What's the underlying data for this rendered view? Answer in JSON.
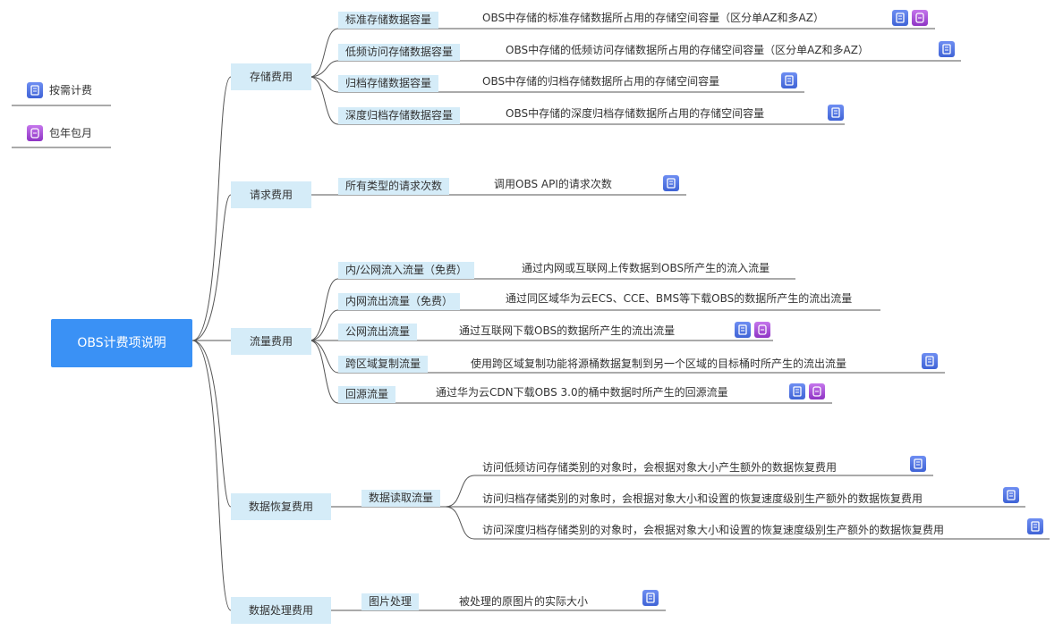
{
  "legend": [
    {
      "icon": "ondemand-icon",
      "label": "按需计费"
    },
    {
      "icon": "yearly-monthly-icon",
      "label": "包年包月"
    }
  ],
  "root": "OBS计费项说明",
  "categories": [
    {
      "label": "存储费用",
      "items": [
        {
          "label": "标准存储数据容量",
          "desc": "OBS中存储的标准存储数据所占用的存储空间容量（区分单AZ和多AZ）",
          "billing": [
            "ondemand",
            "yearly"
          ]
        },
        {
          "label": "低频访问存储数据容量",
          "desc": "OBS中存储的低频访问存储数据所占用的存储空间容量（区分单AZ和多AZ）",
          "billing": [
            "ondemand"
          ]
        },
        {
          "label": "归档存储数据容量",
          "desc": "OBS中存储的归档存储数据所占用的存储空间容量",
          "billing": [
            "ondemand"
          ]
        },
        {
          "label": "深度归档存储数据容量",
          "desc": "OBS中存储的深度归档存储数据所占用的存储空间容量",
          "billing": [
            "ondemand"
          ]
        }
      ]
    },
    {
      "label": "请求费用",
      "items": [
        {
          "label": "所有类型的请求次数",
          "desc": "调用OBS API的请求次数",
          "billing": [
            "ondemand"
          ]
        }
      ]
    },
    {
      "label": "流量费用",
      "items": [
        {
          "label": "内/公网流入流量（免费）",
          "desc": "通过内网或互联网上传数据到OBS所产生的流入流量",
          "billing": []
        },
        {
          "label": "内网流出流量（免费）",
          "desc": "通过同区域华为云ECS、CCE、BMS等下载OBS的数据所产生的流出流量",
          "billing": []
        },
        {
          "label": "公网流出流量",
          "desc": "通过互联网下载OBS的数据所产生的流出流量",
          "billing": [
            "ondemand",
            "yearly"
          ]
        },
        {
          "label": "跨区域复制流量",
          "desc": "使用跨区域复制功能将源桶数据复制到另一个区域的目标桶时所产生的流出流量",
          "billing": [
            "ondemand"
          ]
        },
        {
          "label": "回源流量",
          "desc": "通过华为云CDN下载OBS 3.0的桶中数据时所产生的回源流量",
          "billing": [
            "ondemand",
            "yearly"
          ]
        }
      ]
    },
    {
      "label": "数据恢复费用",
      "items": [
        {
          "label": "数据读取流量",
          "descs": [
            {
              "desc": "访问低频访问存储类别的对象时，会根据对象大小产生额外的数据恢复费用",
              "billing": [
                "ondemand"
              ]
            },
            {
              "desc": "访问归档存储类别的对象时，会根据对象大小和设置的恢复速度级别生产额外的数据恢复费用",
              "billing": [
                "ondemand"
              ]
            },
            {
              "desc": "访问深度归档存储类别的对象时，会根据对象大小和设置的恢复速度级别生产额外的数据恢复费用",
              "billing": [
                "ondemand"
              ]
            }
          ]
        }
      ]
    },
    {
      "label": "数据处理费用",
      "items": [
        {
          "label": "图片处理",
          "desc": "被处理的原图片的实际大小",
          "billing": [
            "ondemand"
          ]
        }
      ]
    }
  ],
  "colors": {
    "root": "#3a91f5",
    "node_bg": "#d5ecf8",
    "line": "#555555",
    "ondemand": "#4a6fe3",
    "yearly": "#a14fd8"
  }
}
